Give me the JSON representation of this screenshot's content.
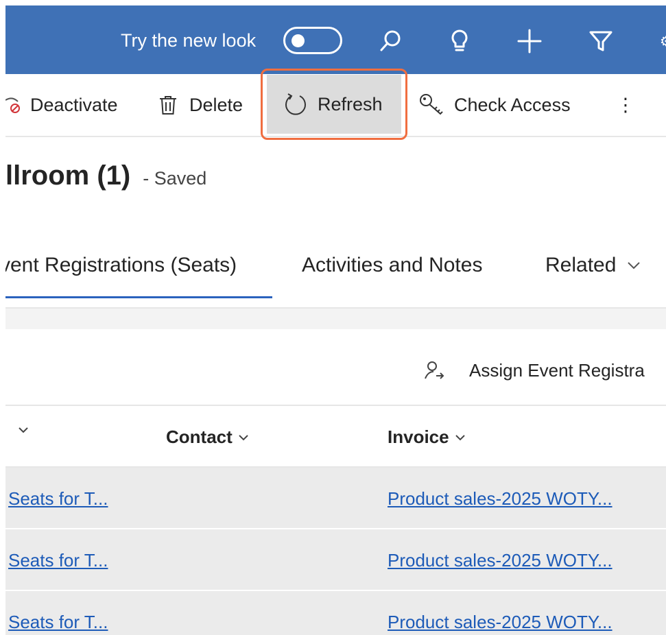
{
  "topbar": {
    "try_new_look_label": "Try the new look",
    "toggle_state": "off",
    "icons": [
      "search-icon",
      "lightbulb-icon",
      "plus-icon",
      "filter-icon"
    ],
    "background_color": "#3f71b6"
  },
  "commandbar": {
    "deactivate_label": "Deactivate",
    "delete_label": "Delete",
    "refresh_label": "Refresh",
    "check_access_label": "Check Access",
    "more_label": "⋮",
    "highlight_color": "#f06e40"
  },
  "record": {
    "title": "llroom (1)",
    "status": "- Saved"
  },
  "tabs": [
    {
      "label": "vent Registrations (Seats)",
      "active": true
    },
    {
      "label": "Activities and Notes",
      "active": false
    },
    {
      "label": "Related",
      "active": false
    }
  ],
  "subgrid": {
    "assign_label": "Assign Event Registra",
    "columns": [
      "",
      "Contact",
      "Invoice"
    ],
    "rows": [
      {
        "name": "Seats for T...",
        "contact": "",
        "invoice": "Product sales-2025 WOTY..."
      },
      {
        "name": "Seats for T...",
        "contact": "",
        "invoice": "Product sales-2025 WOTY..."
      },
      {
        "name": "Seats for T...",
        "contact": "",
        "invoice": "Product sales-2025 WOTY..."
      }
    ]
  }
}
